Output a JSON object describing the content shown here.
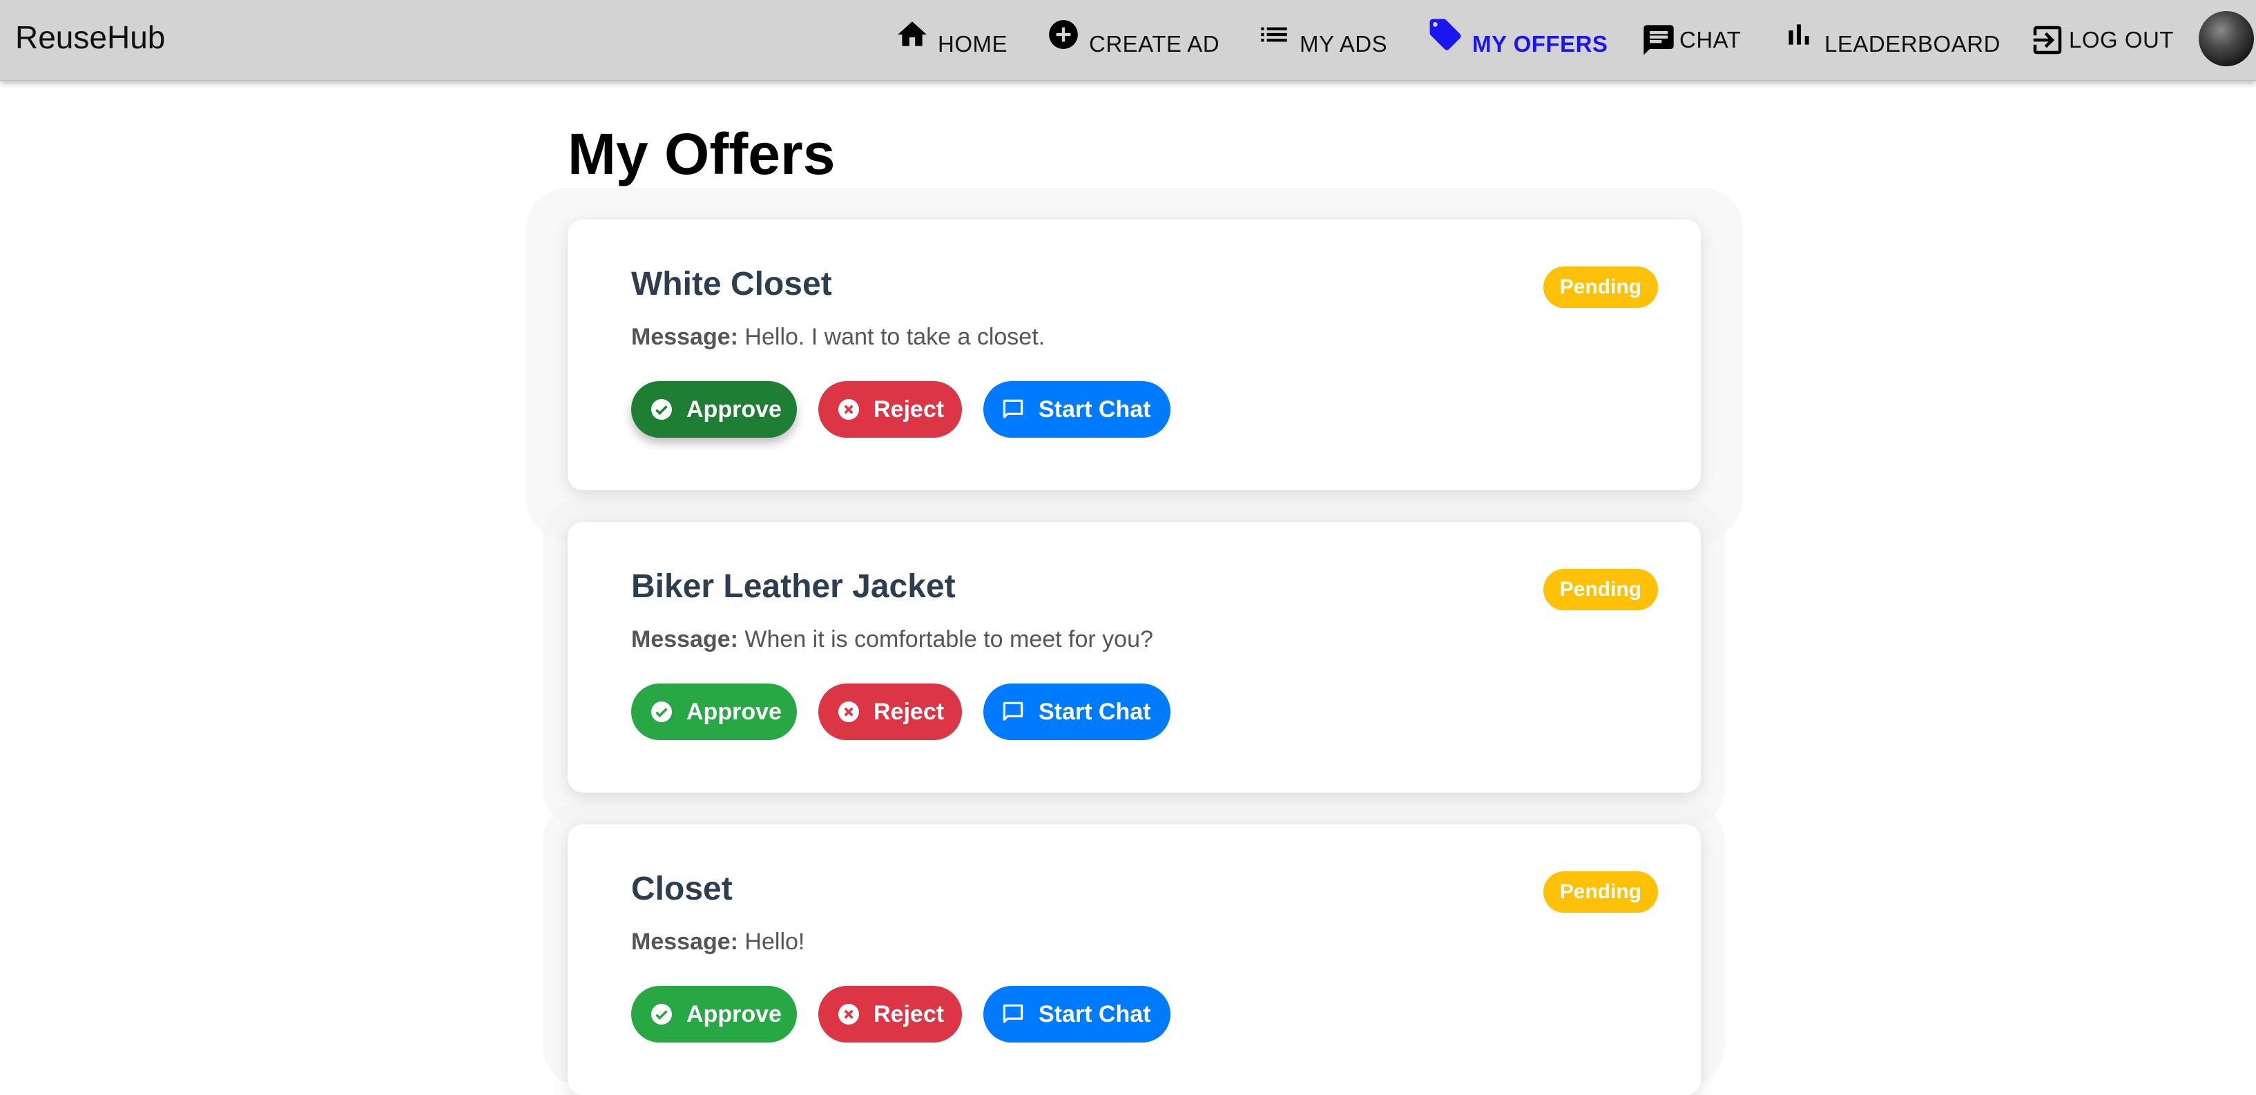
{
  "app": {
    "brand": "ReuseHub"
  },
  "nav": {
    "home": "HOME",
    "create_ad": "CREATE AD",
    "my_ads": "MY ADS",
    "my_offers": "MY OFFERS",
    "chat": "CHAT",
    "leaderboard": "LEADERBOARD",
    "logout": "LOG OUT",
    "active": "MY OFFERS",
    "active_color": "#1a16f0"
  },
  "page": {
    "title": "My Offers"
  },
  "offers": [
    {
      "title": "White Closet",
      "status": "Pending",
      "message_label": "Message:",
      "message": "Hello. I want to take a closet.",
      "approve_label": "Approve",
      "reject_label": "Reject",
      "chat_label": "Start Chat"
    },
    {
      "title": "Biker Leather Jacket",
      "status": "Pending",
      "message_label": "Message:",
      "message": "When it is comfortable to meet for you?",
      "approve_label": "Approve",
      "reject_label": "Reject",
      "chat_label": "Start Chat"
    },
    {
      "title": "Closet",
      "status": "Pending",
      "message_label": "Message:",
      "message": "Hello!",
      "approve_label": "Approve",
      "reject_label": "Reject",
      "chat_label": "Start Chat"
    }
  ],
  "colors": {
    "navbar_bg": "#d3d3d3",
    "approve": "#28a745",
    "reject": "#dc3545",
    "start_chat": "#007bff",
    "pending_badge": "#ffc107",
    "card_title": "#2c3e50"
  },
  "icons": {
    "home": "home-icon",
    "create_ad": "add-circle-icon",
    "my_ads": "list-icon",
    "my_offers": "tag-icon",
    "chat": "chat-icon",
    "leaderboard": "bar-chart-icon",
    "logout": "logout-icon",
    "approve": "check-circle-icon",
    "reject": "cancel-circle-icon",
    "start_chat": "chat-bubble-outline-icon"
  }
}
